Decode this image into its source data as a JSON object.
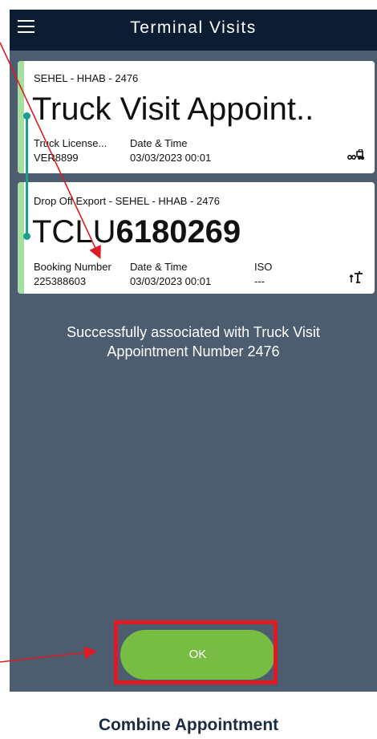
{
  "header": {
    "title": "Terminal Visits"
  },
  "truck_card": {
    "subtitle": "SEHEL - HHAB - 2476",
    "title": "Truck Visit Appoint..",
    "fields": [
      {
        "label": "Truck License...",
        "value": "VER8899"
      },
      {
        "label": "Date & Time",
        "value": "03/03/2023 00:01"
      }
    ],
    "icon": "truck-icon"
  },
  "container_card": {
    "subtitle": "Drop Off Export - SEHEL - HHAB - 2476",
    "title_prefix": "TCLU",
    "title_number": "6180269",
    "fields": [
      {
        "label": "Booking Number",
        "value": "225388603"
      },
      {
        "label": "Date & Time",
        "value": "03/03/2023 00:01"
      },
      {
        "label": "ISO",
        "value": "---"
      }
    ],
    "icon": "crane-icon"
  },
  "message": "Successfully associated with Truck Visit Appointment Number 2476",
  "ok_button": {
    "label": "OK"
  },
  "caption": "Combine Appointment",
  "colors": {
    "header_bg": "#0c1d33",
    "screen_bg": "#4b5d6e",
    "card_bar": "#a6dfa0",
    "timeline": "#1a9e8f",
    "ok_button": "#77bd43",
    "highlight": "#e01a24"
  }
}
